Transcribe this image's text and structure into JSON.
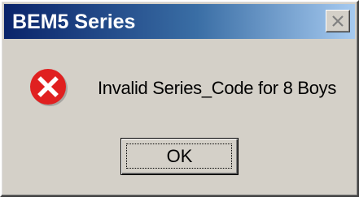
{
  "window": {
    "title": "BEM5 Series",
    "close_icon": "close-icon"
  },
  "dialog": {
    "icon": "error-icon",
    "message": "Invalid Series_Code for 8 Boys",
    "ok_label": "OK"
  },
  "colors": {
    "titlebar_start": "#0a246a",
    "titlebar_end": "#a6caf0",
    "dialog_background": "#d4d0c8",
    "error_red": "#e02020"
  }
}
